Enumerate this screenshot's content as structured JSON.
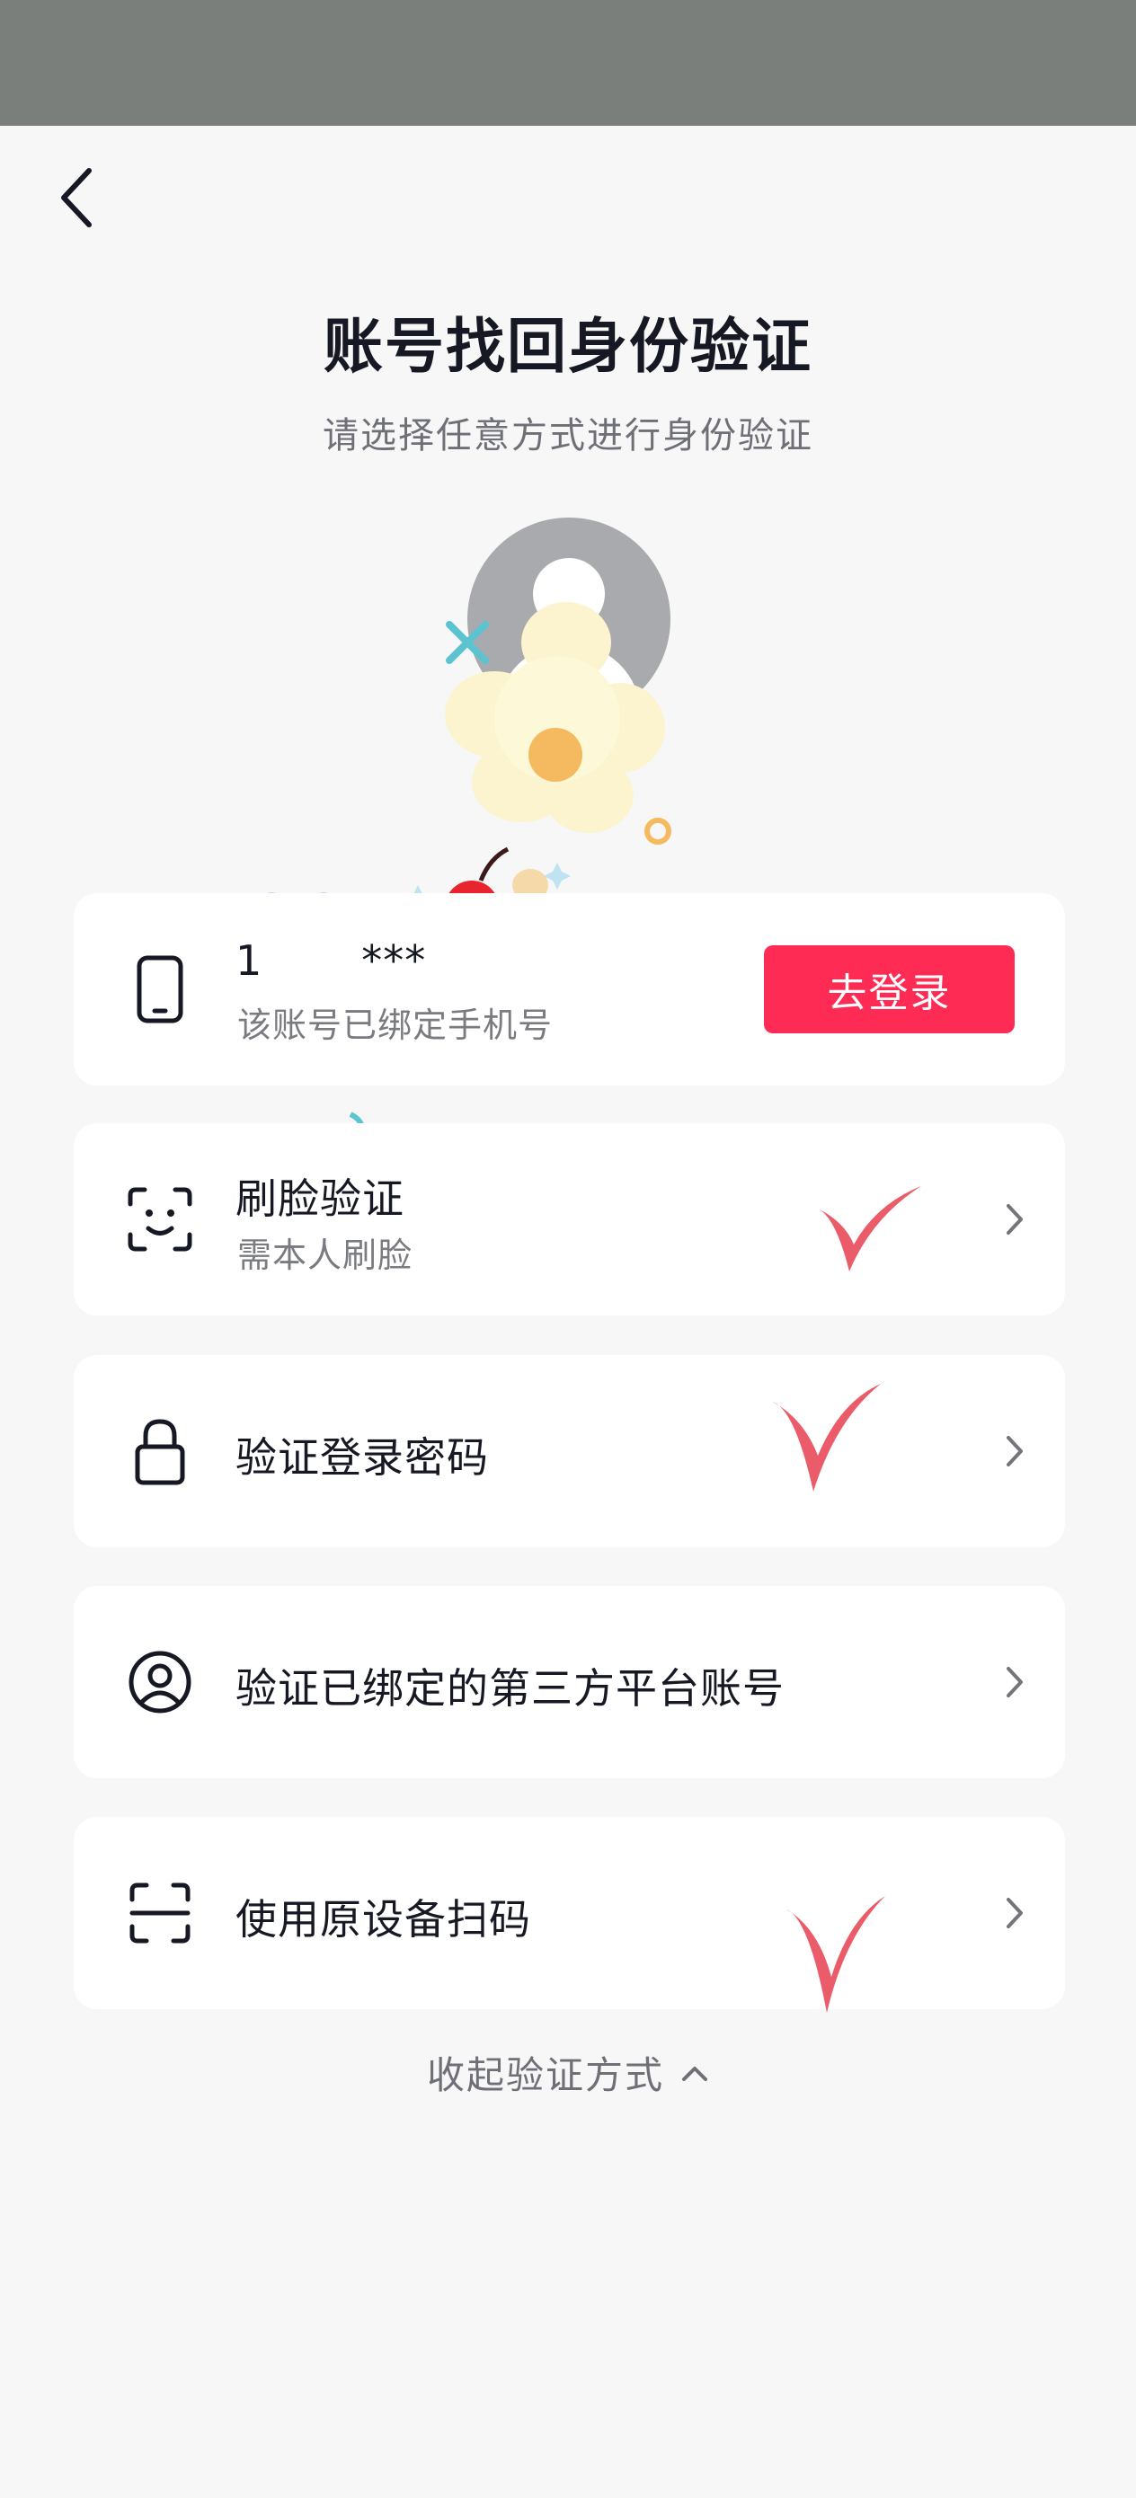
{
  "header": {
    "title": "账号找回身份验证",
    "subtitle": "请选择任意方式进行身份验证"
  },
  "options": [
    {
      "label": "1",
      "masked": "***",
      "sub": "该账号已绑定手机号",
      "button": "去登录",
      "icon": "phone-icon"
    },
    {
      "label": "刷脸验证",
      "sub": "需本人刷脸",
      "icon": "face-scan-icon"
    },
    {
      "label": "验证登录密码",
      "icon": "lock-icon"
    },
    {
      "label": "验证已绑定的第三方平台账号",
      "icon": "user-circle-icon"
    },
    {
      "label": "使用原设备扫码",
      "icon": "scan-icon"
    }
  ],
  "footer": {
    "collapse_label": "收起验证方式",
    "icon": "chevron-up-icon"
  },
  "colors": {
    "accent": "#fe2c55",
    "background": "#f7f7f7",
    "status_bar": "#7b7f7b"
  }
}
